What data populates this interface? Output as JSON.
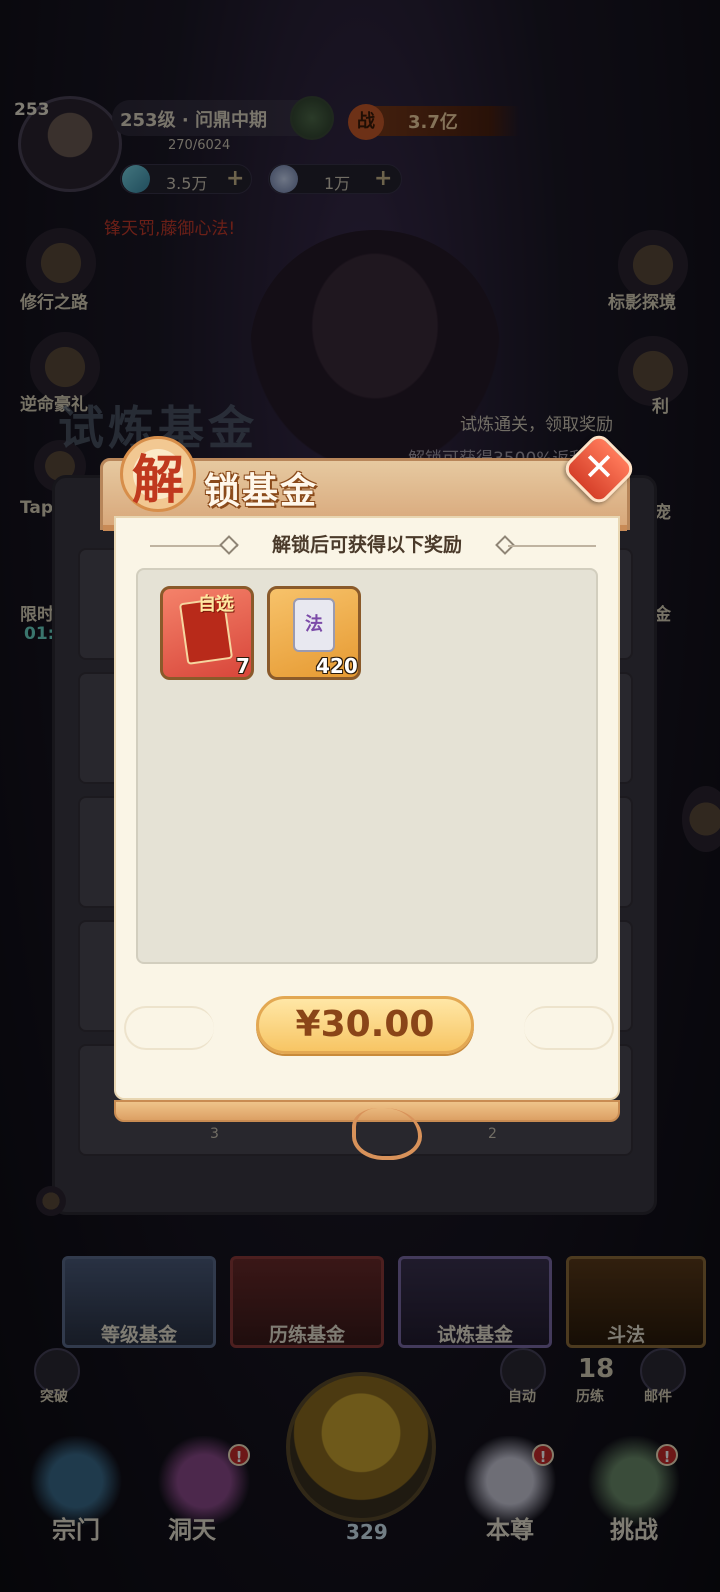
{
  "player": {
    "level_corner": "253",
    "title": "253级 · 问鼎中期",
    "exp": "270/6024",
    "power_badge": "战",
    "power": "3.7亿"
  },
  "resources": [
    {
      "icon": "gem-icon",
      "value": "3.5万"
    },
    {
      "icon": "spirit-coin-icon",
      "value": "1万"
    }
  ],
  "marquee_text": "锋天罚,藤御心法!",
  "left_menu": [
    {
      "label": "修行之路"
    },
    {
      "label": "逆命豪礼"
    },
    {
      "label": "Tap"
    },
    {
      "label": "限时"
    },
    {
      "label": "01:"
    }
  ],
  "right_menu": [
    {
      "label": "标影探境"
    },
    {
      "label": "利"
    },
    {
      "label": "宠"
    },
    {
      "label": "金"
    }
  ],
  "background_page": {
    "title": "试炼基金",
    "info_line1": "试炼通关，领取奖励",
    "info_line2": "解锁可获得3500%返利",
    "chip_left": "3",
    "chip_right": "2"
  },
  "fund_tabs": [
    {
      "label": "等级基金"
    },
    {
      "label": "历练基金"
    },
    {
      "label": "试炼基金"
    },
    {
      "label": "斗法"
    }
  ],
  "bottom_utils": {
    "breakthrough": "突破",
    "auto": "自动",
    "trials_count": "18",
    "trials": "历练",
    "mail": "邮件"
  },
  "nav": [
    {
      "label": "宗门",
      "badge": ""
    },
    {
      "label": "洞天",
      "badge": "!"
    },
    {
      "label": "本尊",
      "badge": "!"
    },
    {
      "label": "挑战",
      "badge": "!"
    }
  ],
  "center_count": "329",
  "modal": {
    "title_first": "解",
    "title_rest": "锁基金",
    "close": "✕",
    "subtitle": "解锁后可获得以下奖励",
    "rewards": [
      {
        "name": "自选",
        "icon": "optional-scroll-icon",
        "count": "7"
      },
      {
        "name": "法",
        "icon": "technique-token-icon",
        "count": "420"
      }
    ],
    "price": "¥30.00"
  }
}
